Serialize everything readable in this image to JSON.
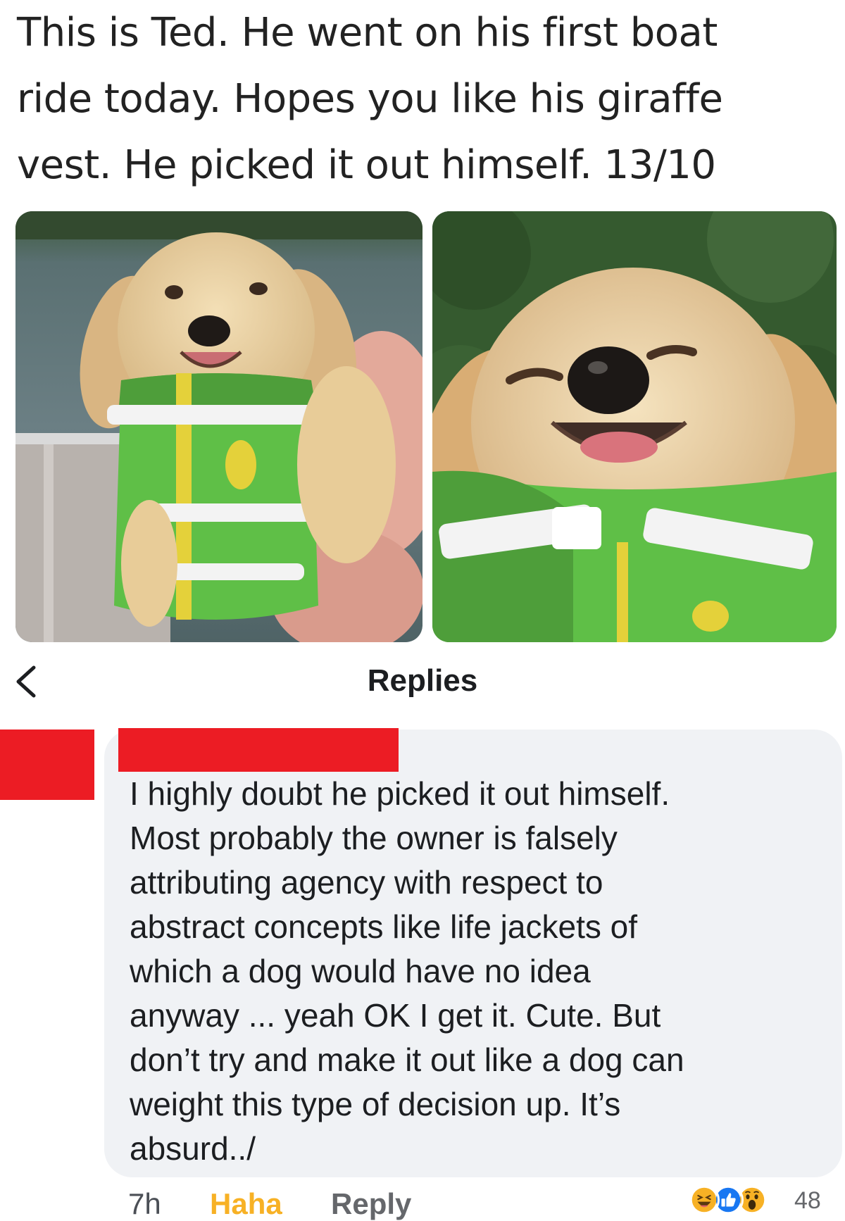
{
  "post": {
    "text_lines": [
      "This is Ted. He went on his first boat",
      "ride today. Hopes you like his giraffe",
      "vest. He picked it out himself. 13/10"
    ],
    "photos": [
      "puppy-photo-left",
      "puppy-photo-right"
    ]
  },
  "replies_header": {
    "title": "Replies",
    "back_icon": "chevron-left-icon"
  },
  "comment": {
    "text_lines": [
      "I highly doubt he picked it out himself.",
      "Most probably the owner is falsely",
      "attributing agency with respect to",
      "abstract concepts like life jackets of",
      "which a dog would have no idea",
      "anyway ... yeah OK I get it. Cute. But",
      "don’t try and make it out like a dog can",
      "weight this type of decision up. It’s",
      "absurd../"
    ],
    "time": "7h",
    "reaction_label": "Haha",
    "reply_label": "Reply",
    "reaction_icons": [
      "haha-icon",
      "like-icon",
      "wow-icon"
    ],
    "reaction_count": "48",
    "colors": {
      "redaction": "#ec1c24",
      "haha": "#f7b125",
      "bubble": "#f0f2f5",
      "like": "#1877f2"
    }
  }
}
